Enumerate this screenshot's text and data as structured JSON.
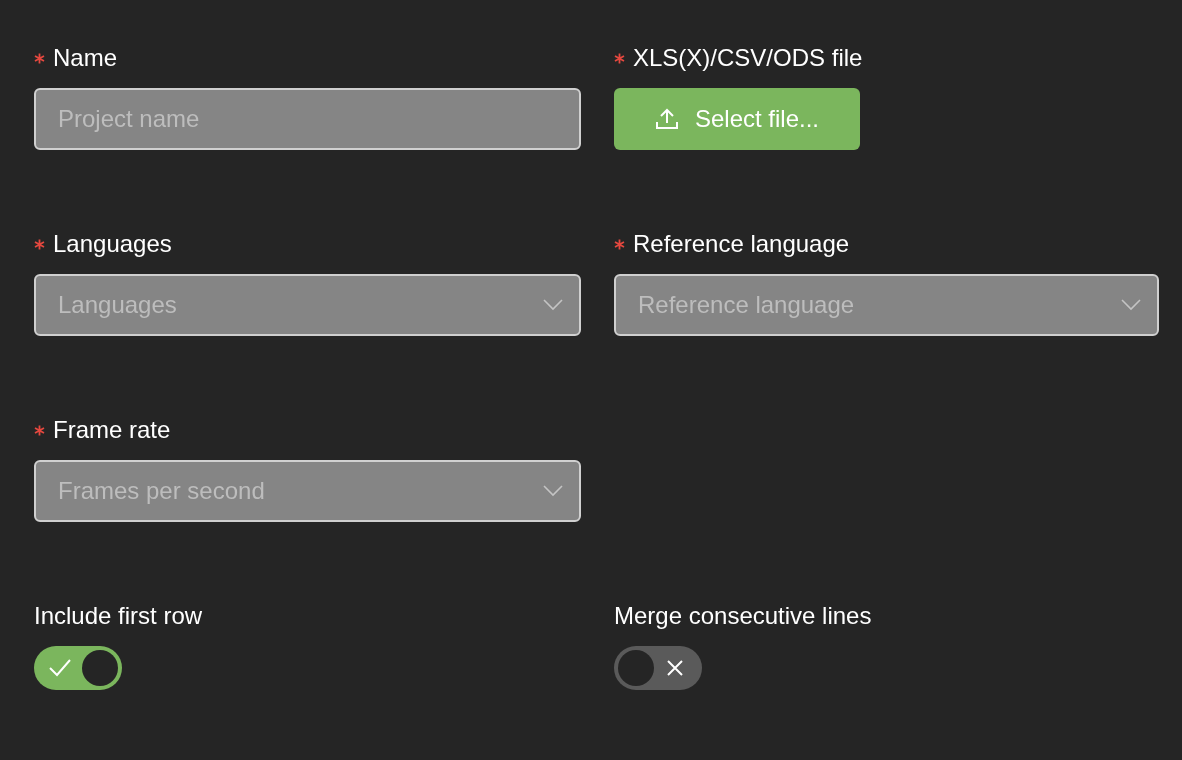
{
  "fields": [
    {
      "label": "Name",
      "required": true,
      "kind": "text",
      "placeholder": "Project name"
    },
    {
      "label": "XLS(X)/CSV/ODS file",
      "required": true,
      "kind": "file",
      "button": "Select file..."
    },
    {
      "label": "Languages",
      "required": true,
      "kind": "select",
      "placeholder": "Languages"
    },
    {
      "label": "Reference language",
      "required": true,
      "kind": "select",
      "placeholder": "Reference language"
    },
    {
      "label": "Frame rate",
      "required": true,
      "kind": "select",
      "placeholder": "Frames per second"
    }
  ],
  "switches": [
    {
      "label": "Include first row",
      "on": true
    },
    {
      "label": "Merge consecutive lines",
      "on": false
    }
  ]
}
